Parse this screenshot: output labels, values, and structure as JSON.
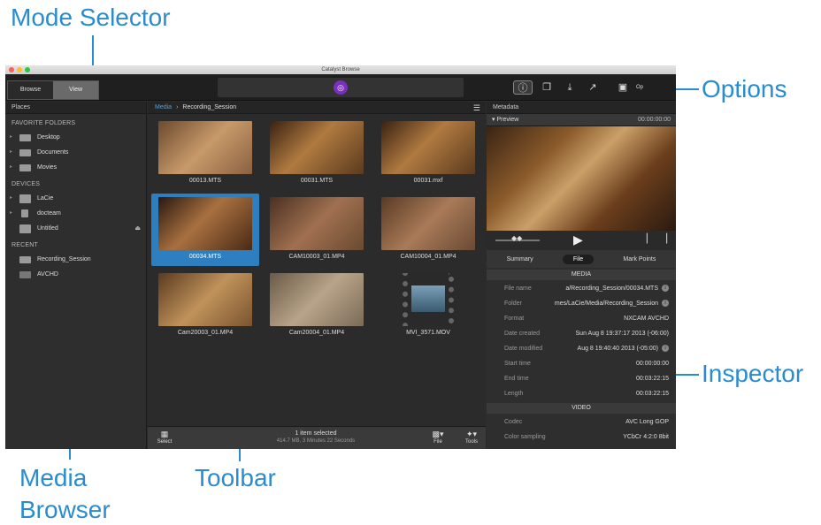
{
  "callouts": {
    "mode_selector": "Mode Selector",
    "options": "Options",
    "inspector": "Inspector",
    "media_browser_line1": "Media",
    "media_browser_line2": "Browser",
    "toolbar": "Toolbar"
  },
  "window": {
    "title": "Catalyst Browse",
    "mode_tabs": [
      "Browse",
      "View"
    ]
  },
  "places": {
    "header": "Places",
    "favorites_title": "FAVORITE FOLDERS",
    "favorites": [
      "Desktop",
      "Documents",
      "Movies"
    ],
    "devices_title": "DEVICES",
    "devices": [
      "LaCie",
      "docteam",
      "Untitled"
    ],
    "recent_title": "RECENT",
    "recent": [
      "Recording_Session",
      "AVCHD"
    ]
  },
  "browser": {
    "breadcrumb_root": "Media",
    "breadcrumb_current": "Recording_Session",
    "clips": [
      {
        "name": "00013.MTS"
      },
      {
        "name": "00031.MTS"
      },
      {
        "name": "00031.mxf"
      },
      {
        "name": "00034.MTS"
      },
      {
        "name": "CAM10003_01.MP4"
      },
      {
        "name": "CAM10004_01.MP4"
      },
      {
        "name": "Cam20003_01.MP4"
      },
      {
        "name": "Cam20004_01.MP4"
      },
      {
        "name": "MVI_3571.MOV"
      }
    ]
  },
  "toolbar": {
    "select_label": "Select",
    "status": "1 item selected",
    "size": "414.7 MB, 3 Minutes 22 Seconds",
    "file_label": "File",
    "tools_label": "Tools"
  },
  "inspector": {
    "header": "Metadata",
    "preview_label": "Preview",
    "timecode": "00:00:00:00",
    "tabs": [
      "Summary",
      "File",
      "Mark Points"
    ],
    "media_group": "MEDIA",
    "video_group": "VIDEO",
    "media_rows": [
      {
        "key": "File name",
        "value": "a/Recording_Session/00034.MTS"
      },
      {
        "key": "Folder",
        "value": "mes/LaCie/Media/Recording_Session"
      },
      {
        "key": "Format",
        "value": "NXCAM AVCHD"
      },
      {
        "key": "Date created",
        "value": "Sun Aug  8 19:37:17 2013 (-06:00)"
      },
      {
        "key": "Date modified",
        "value": "Aug  8 19:40:40 2013 (-05:00)"
      },
      {
        "key": "Start time",
        "value": "00:00:00:00"
      },
      {
        "key": "End time",
        "value": "00:03:22:15"
      },
      {
        "key": "Length",
        "value": "00:03:22:15"
      }
    ],
    "video_rows": [
      {
        "key": "Codec",
        "value": "AVC Long GOP"
      },
      {
        "key": "Color sampling",
        "value": "YCbCr 4:2:0 8bit"
      }
    ]
  },
  "colors": {
    "accent": "#2a8ccf",
    "selection": "#2d7fc0"
  }
}
